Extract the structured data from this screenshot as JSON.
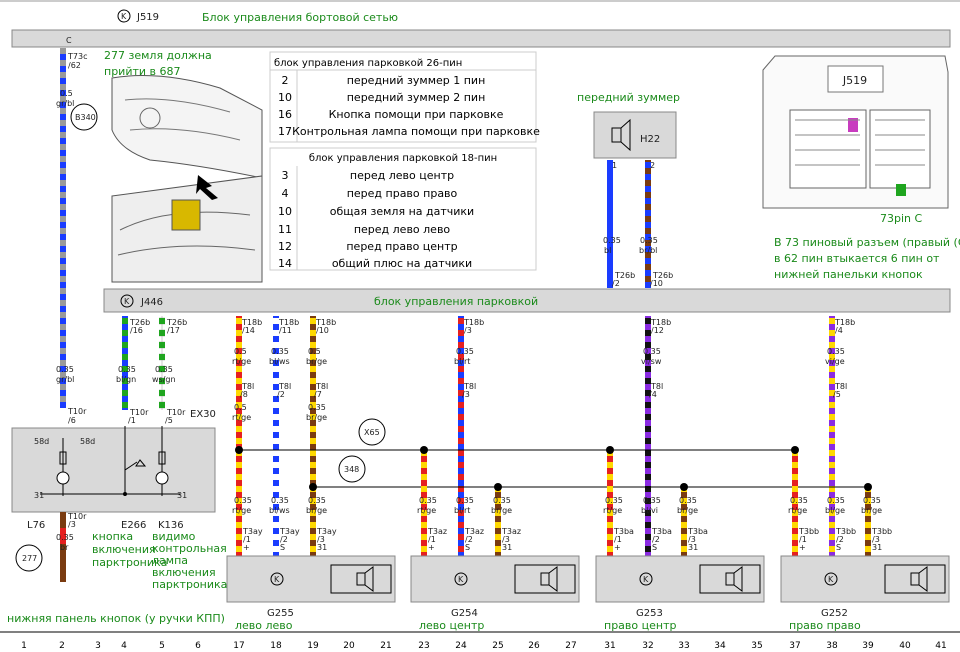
{
  "header": {
    "k_symbol": "K",
    "code": "J519",
    "title": "Блок управления бортовой сетью",
    "pin_c": "C"
  },
  "parking_header": {
    "code": "J446",
    "title": "блок управления парковкой"
  },
  "notes": {
    "ground_note_line1": "277 земля должна",
    "ground_note_line2": "прийти в 687",
    "front_buzzer": "передний зуммер",
    "pin73": "73pin C",
    "j519_box": "J519",
    "connector_note_line1": "В 73 пиновый разъем (правый (С)",
    "connector_note_line2": "в 62 пин втыкается 6 пин от",
    "connector_note_line3": "нижней панельки кнопок",
    "panel_note": "нижняя панель кнопок (у ручки КПП)",
    "button_label": "кнопка включения парктроника",
    "lamp_label": "видимо контрольная лампа включения парктроника"
  },
  "table26": {
    "title": "блок управления парковкой 26-пин",
    "rows": [
      {
        "pin": "2",
        "desc": "передний зуммер 1 пин"
      },
      {
        "pin": "10",
        "desc": "передний зуммер  2 пин"
      },
      {
        "pin": "16",
        "desc": "Кнопка помощи при парковке"
      },
      {
        "pin": "17",
        "desc": "Контрольная лампа помощи при парковке"
      }
    ]
  },
  "table18": {
    "title": "блок управления парковкой 18-пин",
    "rows": [
      {
        "pin": "3",
        "desc": "перед лево центр"
      },
      {
        "pin": "4",
        "desc": "перед право право"
      },
      {
        "pin": "10",
        "desc": "общая земля на датчики"
      },
      {
        "pin": "11",
        "desc": "перед лево лево"
      },
      {
        "pin": "12",
        "desc": "перед право центр"
      },
      {
        "pin": "14",
        "desc": "общий плюс на  датчики"
      }
    ]
  },
  "left_wire": {
    "conn_top": "T73c",
    "pin_top": "/62",
    "size1": "0.5",
    "color1": "gr/bl",
    "splice": "B340",
    "size2": "0.35",
    "color2": "gr/bl",
    "conn_mid": "T10r",
    "pin_mid": "/6",
    "pin58d": "58d",
    "pin31": "31",
    "conn_bot": "T10r",
    "pin_bot": "/3",
    "size3": "0.35",
    "color3": "br",
    "ground": "277",
    "l76": "L76"
  },
  "switch_wires": [
    {
      "conn": "T26b",
      "pin": "/16",
      "size": "0.35",
      "color": "bl/gn",
      "conn2": "T10r",
      "pin2": "/1"
    },
    {
      "conn": "T26b",
      "pin": "/17",
      "size": "0.35",
      "color": "ws/gn",
      "conn2": "T10r",
      "pin2": "/5"
    }
  ],
  "ex30": "EX30",
  "e266": "E266",
  "k136": "K136",
  "buzzer": {
    "code": "H22",
    "p1": "1",
    "p2": "2",
    "w1_size": "0.35",
    "w1_color": "bl",
    "w1_conn": "T26b",
    "w1_pin": "/2",
    "w2_size": "0.35",
    "w2_color": "br/bl",
    "w2_conn": "T26b",
    "w2_pin": "/10"
  },
  "t18_wires": [
    {
      "conn": "T18b",
      "pin": "/14",
      "size": "0.5",
      "color": "rt/ge",
      "c2": "T8l",
      "p2": "/8",
      "size2": "0.5",
      "color2": "rt/ge"
    },
    {
      "conn": "T18b",
      "pin": "/11",
      "size": "0.35",
      "color": "bl/ws",
      "c2": "T8l",
      "p2": "/2",
      "size2": "",
      "color2": ""
    },
    {
      "conn": "T18b",
      "pin": "/10",
      "size": "0.5",
      "color": "br/ge",
      "c2": "T8l",
      "p2": "/7",
      "size2": "0.35",
      "color2": "br/ge"
    },
    {
      "conn": "T18b",
      "pin": "/3",
      "size": "0.35",
      "color": "bl/rt",
      "c2": "T8l",
      "p2": "/3",
      "size2": "",
      "color2": ""
    },
    {
      "conn": "T18b",
      "pin": "/12",
      "size": "0.35",
      "color": "vi/sw",
      "c2": "T8l",
      "p2": "/4",
      "size2": "",
      "color2": ""
    },
    {
      "conn": "T18b",
      "pin": "/4",
      "size": "0.35",
      "color": "vi/ge",
      "c2": "T8l",
      "p2": "/5",
      "size2": "",
      "color2": ""
    }
  ],
  "splices": {
    "x65": "X65",
    "s348": "348"
  },
  "sensors": [
    {
      "code": "G255",
      "name": "лево лево",
      "conn": "T3ay",
      "w": [
        {
          "size": "0.35",
          "color": "rt/ge",
          "pin": "/1",
          "sig": "+"
        },
        {
          "size": "0.35",
          "color": "bl/ws",
          "pin": "/2",
          "sig": "S"
        },
        {
          "size": "0.35",
          "color": "br/ge",
          "pin": "/3",
          "sig": "31"
        }
      ]
    },
    {
      "code": "G254",
      "name": "лево центр",
      "conn": "T3az",
      "w": [
        {
          "size": "0.35",
          "color": "rt/ge",
          "pin": "/1",
          "sig": "+"
        },
        {
          "size": "0.35",
          "color": "bl/rt",
          "pin": "/2",
          "sig": "S"
        },
        {
          "size": "0.35",
          "color": "br/ge",
          "pin": "/3",
          "sig": "31"
        }
      ]
    },
    {
      "code": "G253",
      "name": "право центр",
      "conn": "T3ba",
      "w": [
        {
          "size": "0.35",
          "color": "rt/ge",
          "pin": "/1",
          "sig": "+"
        },
        {
          "size": "0.35",
          "color": "bl/vi",
          "pin": "/2",
          "sig": "S"
        },
        {
          "size": "0.35",
          "color": "br/ge",
          "pin": "/3",
          "sig": "31"
        }
      ]
    },
    {
      "code": "G252",
      "name": "право право",
      "conn": "T3bb",
      "w": [
        {
          "size": "0.35",
          "color": "rt/ge",
          "pin": "/1",
          "sig": "+"
        },
        {
          "size": "0.35",
          "color": "bl/ge",
          "pin": "/2",
          "sig": "S"
        },
        {
          "size": "0.35",
          "color": "br/ge",
          "pin": "/3",
          "sig": "31"
        }
      ]
    }
  ],
  "bottom_numbers": [
    "1",
    "2",
    "3",
    "4",
    "5",
    "6",
    "17",
    "18",
    "19",
    "20",
    "21",
    "23",
    "24",
    "25",
    "26",
    "27",
    "31",
    "32",
    "33",
    "34",
    "35",
    "37",
    "38",
    "39",
    "40",
    "41"
  ]
}
